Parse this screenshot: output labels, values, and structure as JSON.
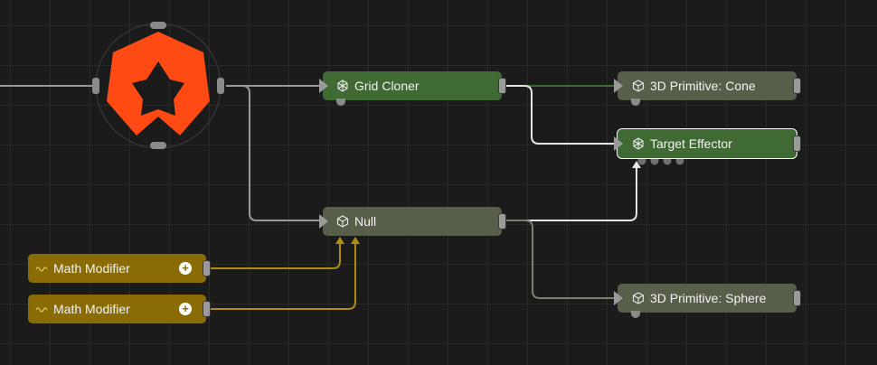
{
  "nodes": {
    "grid_cloner": {
      "label": "Grid Cloner",
      "icon": "cloner-icon"
    },
    "cone": {
      "label": "3D Primitive: Cone",
      "icon": "cube-icon"
    },
    "target_effector": {
      "label": "Target Effector",
      "icon": "effector-icon"
    },
    "null": {
      "label": "Null",
      "icon": "cube-icon"
    },
    "sphere": {
      "label": "3D Primitive: Sphere",
      "icon": "cube-icon"
    },
    "math_modifier_1": {
      "label": "Math Modifier",
      "icon": "wave-icon"
    },
    "math_modifier_2": {
      "label": "Math Modifier",
      "icon": "wave-icon"
    }
  },
  "colors": {
    "logo": "#ff4a13",
    "green_node": "#3f6a34",
    "gray_node": "#575f4b",
    "gold_node": "#8a6c06",
    "wire_white": "#e6e6e6",
    "wire_gray": "#8f8f8f",
    "wire_gold": "#b08c10",
    "wire_green": "#3e6d34"
  }
}
